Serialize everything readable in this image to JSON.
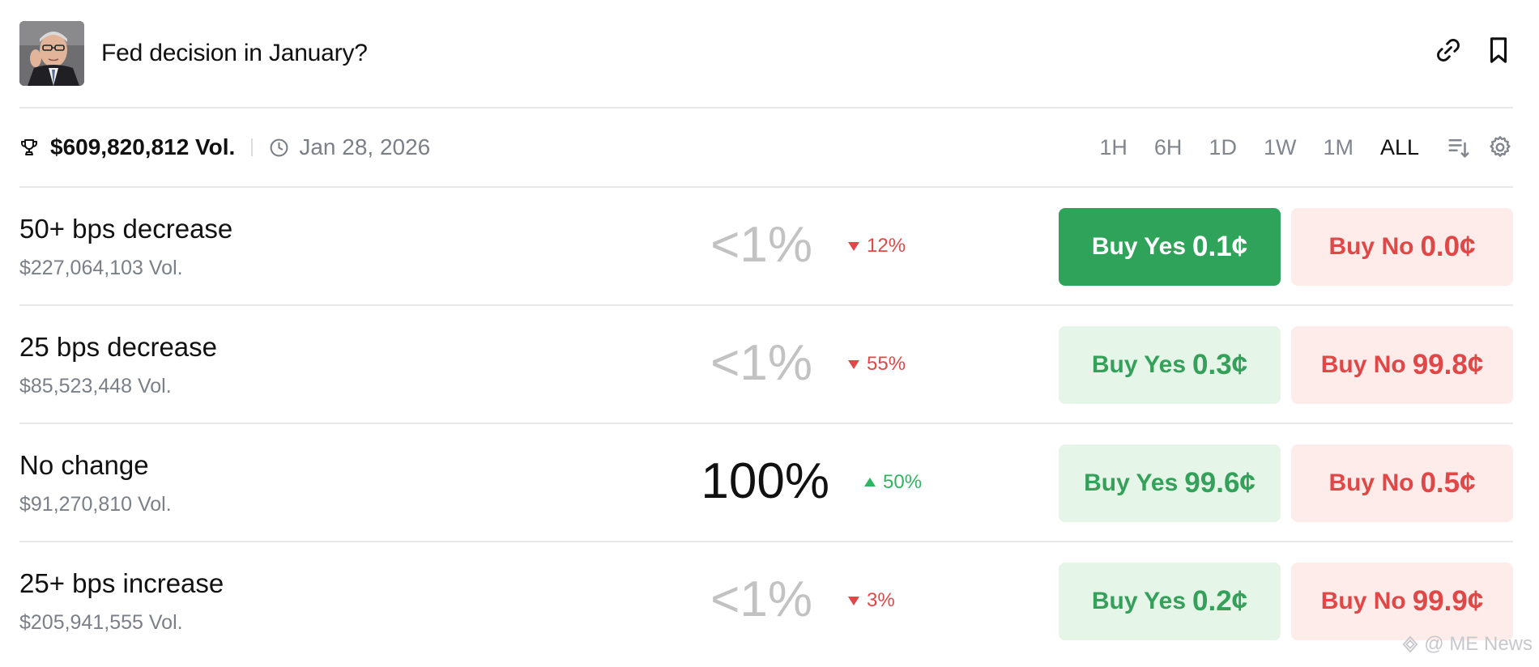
{
  "header": {
    "title": "Fed decision in January?",
    "avatar_alt": "market-portrait"
  },
  "subheader": {
    "volume": "$609,820,812 Vol.",
    "date": "Jan 28, 2026",
    "ranges": [
      "1H",
      "6H",
      "1D",
      "1W",
      "1M",
      "ALL"
    ],
    "active_range": "ALL"
  },
  "rows": [
    {
      "name": "50+ bps decrease",
      "volume": "$227,064,103 Vol.",
      "probability": "<1%",
      "change": "12%",
      "direction": "down",
      "yes_label": "Buy Yes",
      "yes_price": "0.1¢",
      "no_label": "Buy No",
      "no_price": "0.0¢"
    },
    {
      "name": "25 bps decrease",
      "volume": "$85,523,448 Vol.",
      "probability": "<1%",
      "change": "55%",
      "direction": "down",
      "yes_label": "Buy Yes",
      "yes_price": "0.3¢",
      "no_label": "Buy No",
      "no_price": "99.8¢"
    },
    {
      "name": "No change",
      "volume": "$91,270,810 Vol.",
      "probability": "100%",
      "change": "50%",
      "direction": "up",
      "yes_label": "Buy Yes",
      "yes_price": "99.6¢",
      "no_label": "Buy No",
      "no_price": "0.5¢"
    },
    {
      "name": "25+ bps increase",
      "volume": "$205,941,555 Vol.",
      "probability": "<1%",
      "change": "3%",
      "direction": "down",
      "yes_label": "Buy Yes",
      "yes_price": "0.2¢",
      "no_label": "Buy No",
      "no_price": "99.9¢"
    }
  ],
  "colors": {
    "yes_solid": "#30a35a",
    "yes_soft": "#e5f5e7",
    "no_soft": "#fdecea",
    "down": "#e04848",
    "up": "#30b562"
  },
  "icons": {
    "header": [
      "link-icon",
      "bookmark-icon"
    ],
    "subheader": [
      "trophy-icon",
      "clock-icon",
      "sort-icon",
      "gear-icon"
    ]
  },
  "watermark": "@ ME News"
}
